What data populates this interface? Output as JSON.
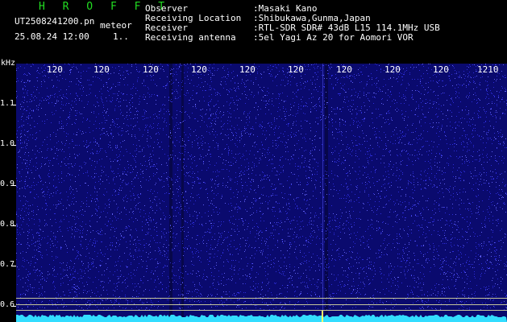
{
  "header": {
    "brand": "H R O F F T",
    "filename": "UT2508241200.pn",
    "filename_suffix": "meteor",
    "datetime": "25.08.24 12:00",
    "extra": "1..",
    "info": [
      {
        "key": "Observer",
        "value": ":Masaki Kano"
      },
      {
        "key": "Receiving Location",
        "value": ":Shibukawa,Gunma,Japan"
      },
      {
        "key": "Receiver",
        "value": ":RTL-SDR SDR# 43dB L15 114.1MHz USB"
      },
      {
        "key": "Receiving antenna",
        "value": ":5el Yagi Az 20 for Aomori VOR"
      }
    ]
  },
  "axis": {
    "y_unit": "kHz",
    "y_ticks": [
      "1.1",
      "1.0",
      "0.9",
      "0.8",
      "0.7",
      "0.6"
    ],
    "x_ticks": [
      "120",
      "120",
      "120",
      "120",
      "120",
      "120",
      "120",
      "120",
      "120",
      "1210"
    ]
  },
  "colors": {
    "background": "#000000",
    "plot_bg": "#0a0a6e",
    "noise": "#3a3aff",
    "trace": "#33ddff",
    "brand": "#22dd22",
    "marker_line": "#d8d8a0"
  }
}
